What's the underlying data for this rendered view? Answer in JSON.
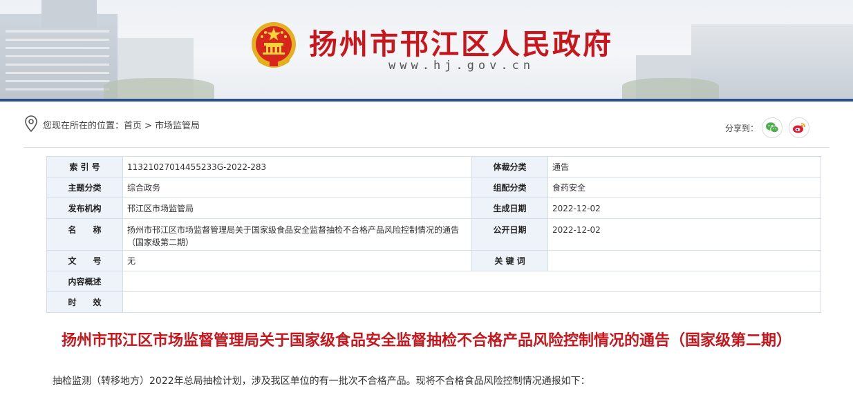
{
  "header": {
    "site_title": "扬州市邗江区人民政府",
    "site_domain": "www.hj.gov.cn"
  },
  "breadcrumb": {
    "prefix": "您现在所在的位置：",
    "items": [
      "首页",
      "市场监管局"
    ],
    "separator": ">"
  },
  "share": {
    "label": "分享到：",
    "buttons": [
      {
        "name": "wechat",
        "icon": "wechat-icon",
        "color": "#4cae4c"
      },
      {
        "name": "weibo",
        "icon": "weibo-icon",
        "color": "#e6162d"
      }
    ]
  },
  "meta": {
    "rows": [
      {
        "k1": "索 引 号",
        "v1": "11321027014455233G-2022-283",
        "k2": "体裁分类",
        "v2": "通告"
      },
      {
        "k1": "主题分类",
        "v1": "综合政务",
        "k2": "组配分类",
        "v2": "食药安全"
      },
      {
        "k1": "发布机构",
        "v1": "邗江区市场监管局",
        "k2": "生成日期",
        "v2": "2022-12-02"
      },
      {
        "k1": "名　　称",
        "v1": "扬州市邗江区市场监督管理局关于国家级食品安全监督抽检不合格产品风险控制情况的通告（国家级第二期）",
        "k2": "公开日期",
        "v2": "2022-12-02"
      },
      {
        "k1": "文　　号",
        "v1": "无",
        "k2": "关 键 词",
        "v2": ""
      },
      {
        "k1": "内容概述",
        "v1": ""
      },
      {
        "k1": "时　　效",
        "v1": ""
      }
    ]
  },
  "article": {
    "title": "扬州市邗江区市场监督管理局关于国家级食品安全监督抽检不合格产品风险控制情况的通告（国家级第二期）",
    "paragraph": "抽检监测（转移地方）2022年总局抽检计划，涉及我区单位的有一批次不合格产品。现将不合格食品风险控制情况通报如下："
  },
  "colors": {
    "brand_red": "#c8161d",
    "banner_line": "#2b4f8e",
    "table_key_bg": "#eef3fa"
  }
}
